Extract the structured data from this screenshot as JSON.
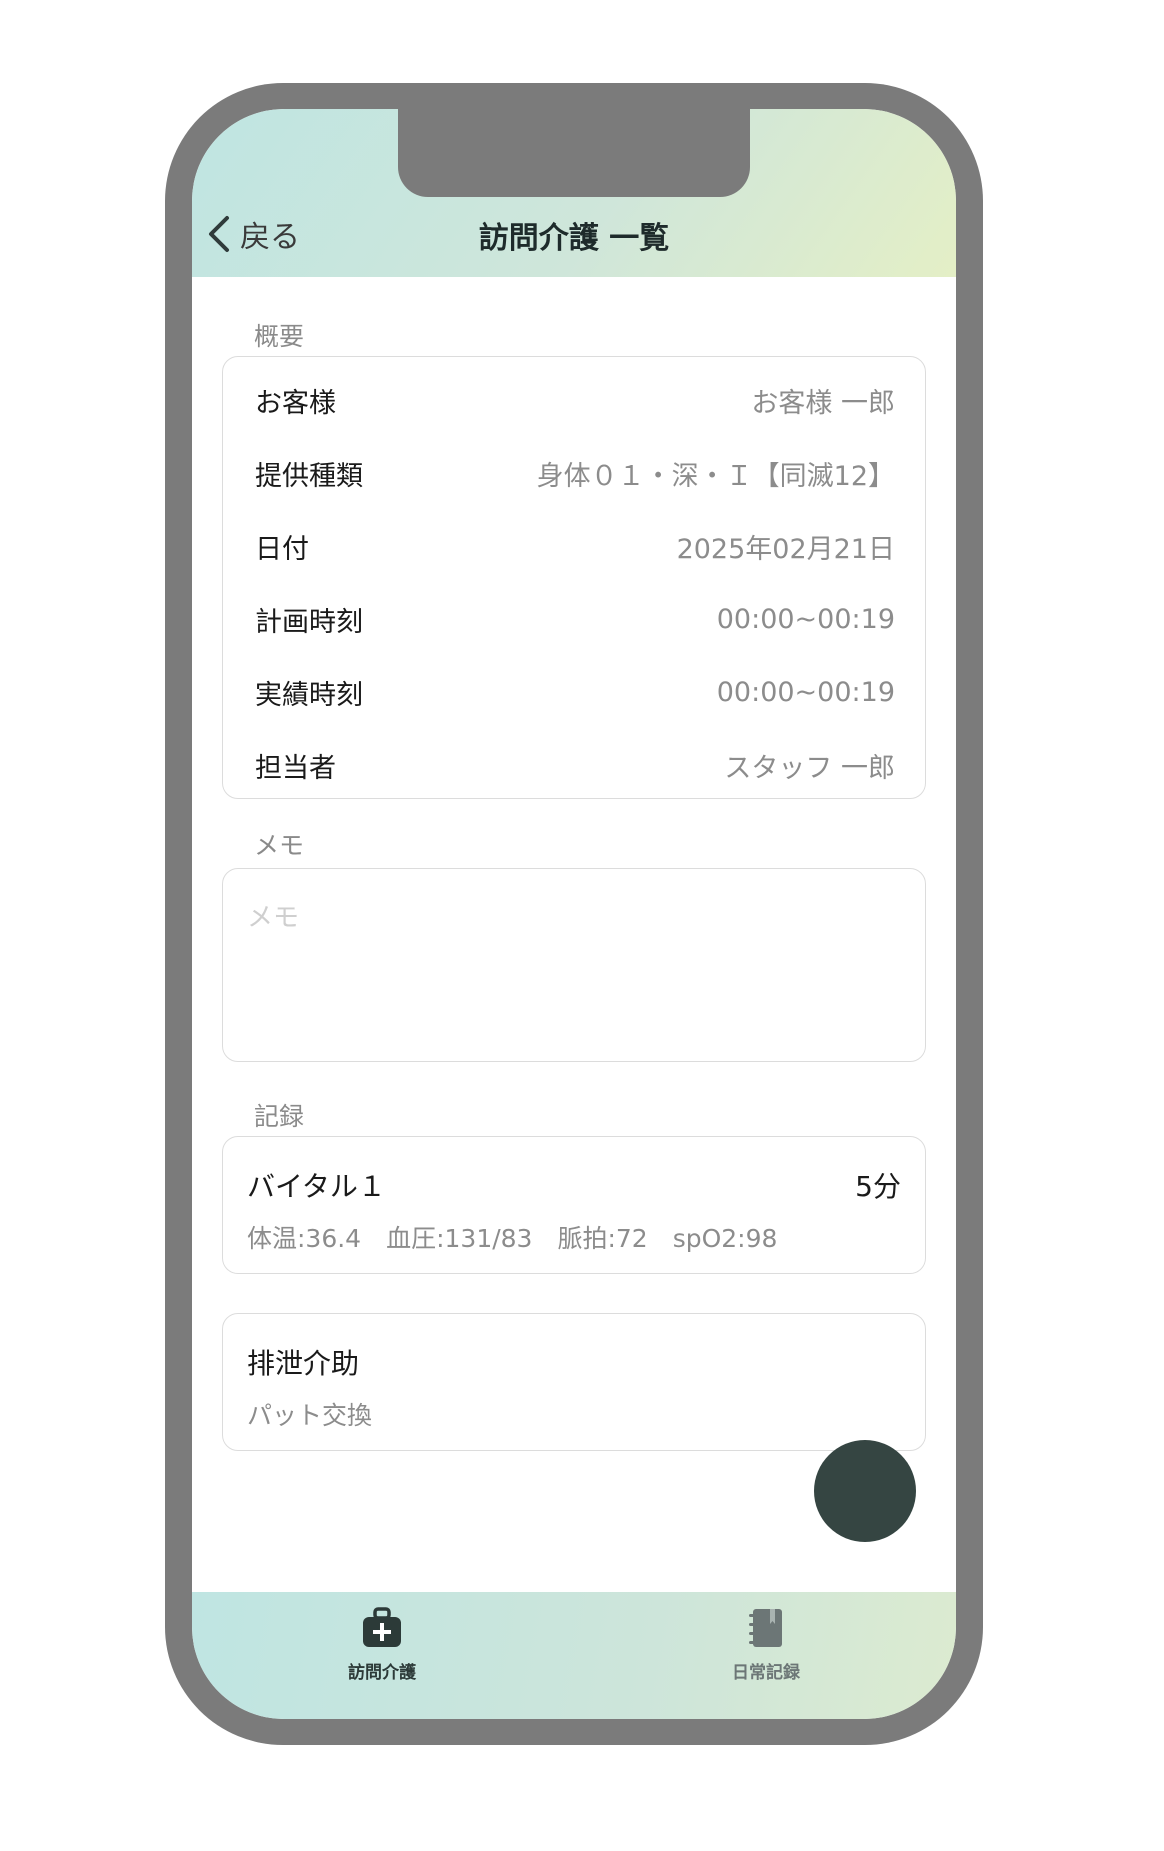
{
  "header": {
    "back_label": "戻る",
    "title": "訪問介護 一覧"
  },
  "summary": {
    "section_label": "概要",
    "rows": [
      {
        "label": "お客様",
        "value": "お客様 一郎"
      },
      {
        "label": "提供種類",
        "value": "身体０１・深・Ｉ【同滅12】"
      },
      {
        "label": "日付",
        "value": "2025年02月21日"
      },
      {
        "label": "計画時刻",
        "value": "00:00~00:19"
      },
      {
        "label": "実績時刻",
        "value": "00:00~00:19"
      },
      {
        "label": "担当者",
        "value": "スタッフ 一郎"
      }
    ]
  },
  "memo": {
    "section_label": "メモ",
    "placeholder": "メモ",
    "value": ""
  },
  "records": {
    "section_label": "記録",
    "items": [
      {
        "title": "バイタル１",
        "duration": "5分",
        "detail": "体温:36.4　血圧:131/83　脈拍:72　spO2:98"
      },
      {
        "title": "排泄介助",
        "duration": "",
        "detail": "パット交換"
      }
    ]
  },
  "tabbar": {
    "tabs": [
      {
        "label": "訪問介護",
        "icon": "medical-bag-icon",
        "active": true
      },
      {
        "label": "日常記録",
        "icon": "notebook-icon",
        "active": false
      }
    ]
  },
  "colors": {
    "header_gradient_start": "#bfe5e2",
    "header_gradient_end": "#e4efc6",
    "fab": "#354542",
    "active_tab": "#2c3a38",
    "inactive_tab": "#6c7676"
  }
}
